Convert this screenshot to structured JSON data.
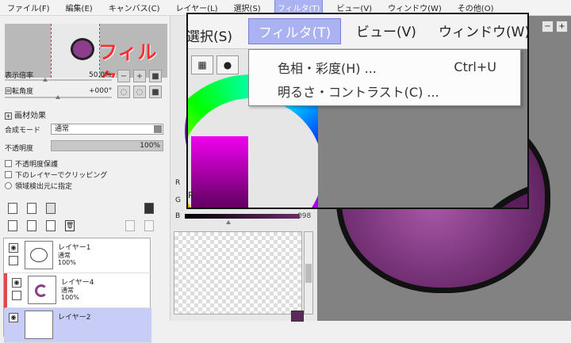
{
  "menubar": {
    "items": [
      "ファイル(F)",
      "編集(E)",
      "キャンバス(C)",
      "レイヤー(L)",
      "選択(S)",
      "フィルタ(T)",
      "ビュー(V)",
      "ウィンドウ(W)",
      "その他(O)"
    ],
    "active_index": 5
  },
  "navigator": {
    "annotation": "フィルタ→"
  },
  "view_controls": {
    "zoom_label": "表示倍率",
    "zoom_value": "50.0%",
    "rotation_label": "回転角度",
    "rotation_value": "+000°"
  },
  "texture": {
    "label": "画材効果"
  },
  "blend": {
    "label": "合成モード",
    "value": "通常"
  },
  "opacity": {
    "label": "不透明度",
    "value": "100%"
  },
  "layer_options": {
    "protect_opacity": "不透明度保護",
    "clip_lower": "下のレイヤーでクリッピング",
    "selection_source": "領域検出元に指定"
  },
  "layers": [
    {
      "name": "レイヤー1",
      "mode": "通常",
      "opacity": "100%",
      "selected": false
    },
    {
      "name": "レイヤー4",
      "mode": "通常",
      "opacity": "100%",
      "selected": false
    },
    {
      "name": "レイヤー2",
      "mode": "",
      "opacity": "",
      "selected": true
    }
  ],
  "color": {
    "channels": [
      "R",
      "G",
      "B"
    ],
    "b_value": "098",
    "accent": "#5b2a5b"
  },
  "zoom_overlay": {
    "left_fragment": "選択(S)",
    "menu_filter": "フィルタ(T)",
    "menu_view": "ビュー(V)",
    "menu_window": "ウィンドウ(W)",
    "dropdown": [
      {
        "label": "色相・彩度(H) ...",
        "shortcut": "Ctrl+U"
      },
      {
        "label": "明るさ・コントラスト(C) ...",
        "shortcut": ""
      }
    ]
  },
  "window_buttons": {
    "minus": "−",
    "plus": "+"
  }
}
